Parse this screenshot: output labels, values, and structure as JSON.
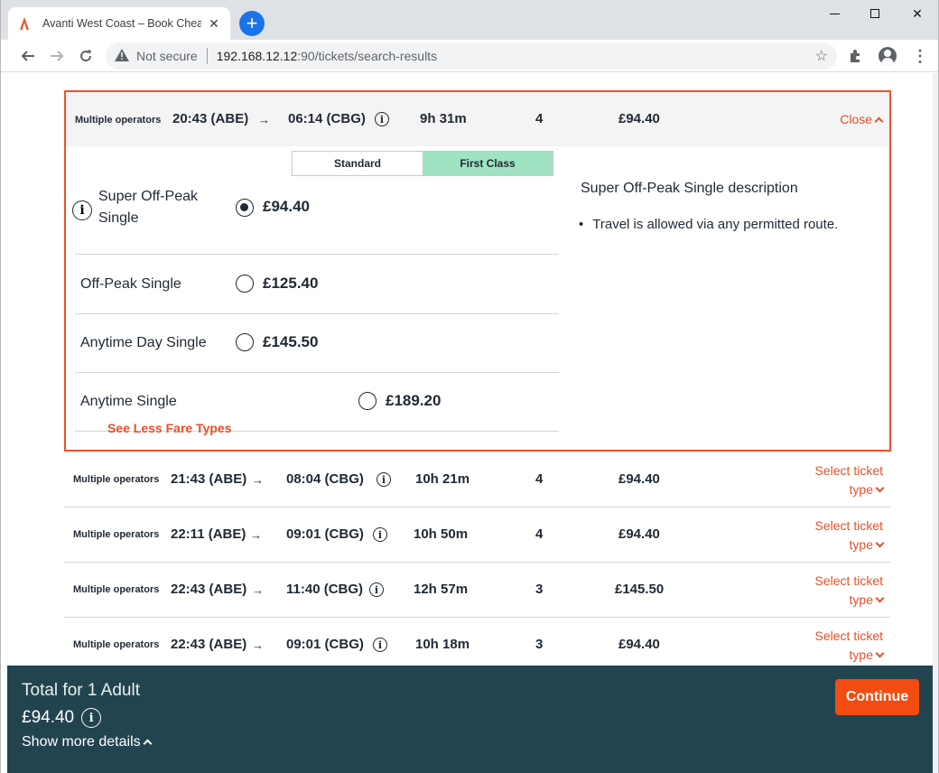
{
  "browser": {
    "tab_title": "Avanti West Coast – Book Cheap",
    "not_secure": "Not secure",
    "url_host": "192.168.12.12",
    "url_path": ":90/tickets/search-results"
  },
  "expanded_journey": {
    "operator": "Multiple operators",
    "depart": "20:43 (ABE)",
    "arrive": "06:14 (CBG)",
    "duration": "9h 31m",
    "changes": "4",
    "price": "£94.40",
    "close_label": "Close",
    "class_tabs": [
      "Standard",
      "First Class"
    ],
    "active_class": "First Class",
    "fares": [
      {
        "name_line1": "Super Off-Peak",
        "name_line2": "Single",
        "price": "£94.40",
        "selected": true
      },
      {
        "name_line1": "Off-Peak Single",
        "name_line2": "",
        "price": "£125.40",
        "selected": false
      },
      {
        "name_line1": "Anytime Day Single",
        "name_line2": "",
        "price": "£145.50",
        "selected": false
      },
      {
        "name_line1": "Anytime Single",
        "name_line2": "",
        "price": "£189.20",
        "selected": false
      }
    ],
    "see_less": "See Less Fare Types",
    "description_title": "Super Off-Peak Single description",
    "description_items": [
      "Travel is allowed via any permitted route."
    ]
  },
  "journeys": [
    {
      "operator": "Multiple operators",
      "depart": "21:43 (ABE)",
      "arrive": "08:04 (CBG)",
      "duration": "10h 21m",
      "changes": "4",
      "price": "£94.40",
      "select_line1": "Select ticket",
      "select_line2": "type"
    },
    {
      "operator": "Multiple operators",
      "depart": "22:11 (ABE)",
      "arrive": "09:01 (CBG)",
      "duration": "10h 50m",
      "changes": "4",
      "price": "£94.40",
      "select_line1": "Select ticket",
      "select_line2": "type"
    },
    {
      "operator": "Multiple operators",
      "depart": "22:43 (ABE)",
      "arrive": "11:40 (CBG)",
      "duration": "12h 57m",
      "changes": "3",
      "price": "£145.50",
      "select_line1": "Select ticket",
      "select_line2": "type"
    },
    {
      "operator": "Multiple operators",
      "depart": "22:43 (ABE)",
      "arrive": "09:01 (CBG)",
      "duration": "10h 18m",
      "changes": "3",
      "price": "£94.40",
      "select_line1": "Select ticket",
      "select_line2": "type"
    }
  ],
  "footer": {
    "total_label": "Total for 1 Adult",
    "total_price": "£94.40",
    "more_details": "Show more details",
    "continue_label": "Continue"
  },
  "colors": {
    "accent": "#f0512c",
    "footer_bg": "#22444f",
    "first_class": "#9fe3c2"
  }
}
